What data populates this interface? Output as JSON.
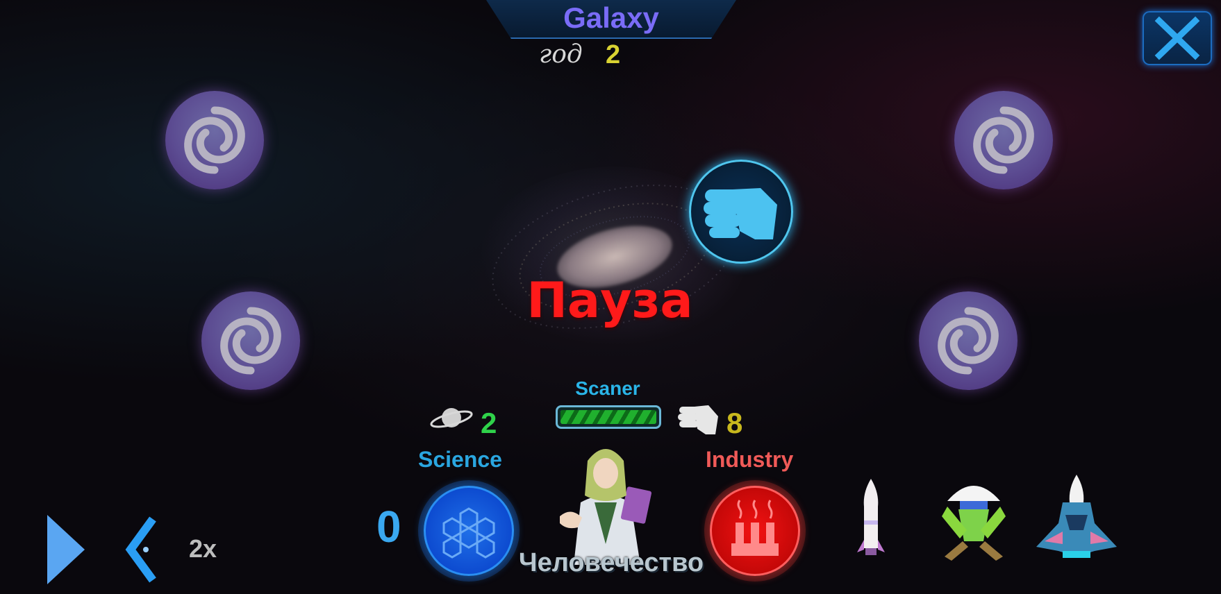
{
  "header": {
    "title": "Galaxy",
    "year_label": "год",
    "year_value": "2"
  },
  "center": {
    "pause_text": "Пауза"
  },
  "stats": {
    "planets_count": "2",
    "scaner_label": "Scaner",
    "scaner_progress": 1.0,
    "fist_count": "8"
  },
  "resources": {
    "science_label": "Science",
    "science_value": "0",
    "industry_label": "Industry"
  },
  "faction": {
    "name": "Человечество"
  },
  "controls": {
    "speed_label": "2x"
  },
  "colors": {
    "title": "#7a6cf7",
    "pause": "#ff1a1a",
    "science": "#2aa6e0",
    "industry": "#f05a58",
    "scaner_fill": "#20b02e",
    "accent_blue": "#4fc6ee"
  },
  "icons": [
    "close-icon",
    "galaxy-swirl-icon",
    "fist-icon",
    "planet-icon",
    "science-honeycomb-icon",
    "industry-factory-icon",
    "play-icon",
    "back-chevron-icon",
    "rocket-icon",
    "lander-ship-icon",
    "fighter-ship-icon"
  ]
}
